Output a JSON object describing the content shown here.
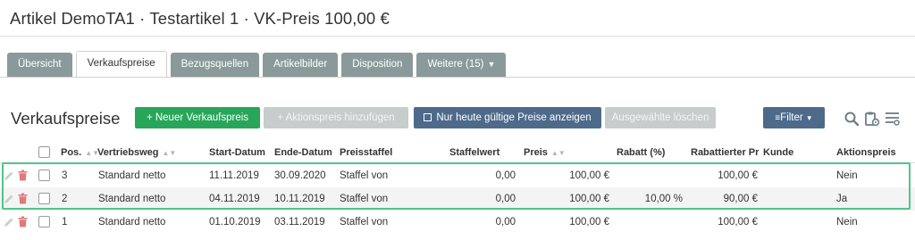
{
  "page": {
    "title": "Artikel DemoTA1 · Testartikel 1 · VK-Preis 100,00 €"
  },
  "tabs": [
    {
      "label": "Übersicht"
    },
    {
      "label": "Verkaufspreise"
    },
    {
      "label": "Bezugsquellen"
    },
    {
      "label": "Artikelbilder"
    },
    {
      "label": "Disposition"
    },
    {
      "label": "Weitere (15)"
    }
  ],
  "section": {
    "title": "Verkaufspreise"
  },
  "toolbar": {
    "new_label": "+  Neuer Verkaufspreis",
    "aktion_label": "+  Aktionspreis hinzufügen",
    "today_label": "Nur heute gültige Preise anzeigen",
    "delete_label": "Ausgewählte löschen",
    "filter_label": "Filter"
  },
  "colors": {
    "accent_green": "#27a65a",
    "accent_blue": "#4d6a8a",
    "tab_gray": "#8a9a9a",
    "highlight": "#4fc48a",
    "delete_red": "#e07a7a"
  },
  "table": {
    "headers": {
      "pos": "Pos.",
      "vertriebsweg": "Vertriebsweg",
      "start": "Start-Datum",
      "ende": "Ende-Datum",
      "staffel": "Preisstaffel",
      "staffelwert": "Staffelwert",
      "preis": "Preis",
      "rabatt": "Rabatt (%)",
      "rabattiert": "Rabattierter Pr",
      "kunde": "Kunde",
      "aktion": "Aktionspreis"
    },
    "rows": [
      {
        "pos": "3",
        "vertriebsweg": "Standard netto",
        "start": "11.11.2019",
        "ende": "30.09.2020",
        "staffel": "Staffel von",
        "staffelwert": "0,00",
        "preis": "100,00 €",
        "rabatt": "",
        "rabattiert": "100,00 €",
        "kunde": "",
        "aktion": "Nein"
      },
      {
        "pos": "2",
        "vertriebsweg": "Standard netto",
        "start": "04.11.2019",
        "ende": "10.11.2019",
        "staffel": "Staffel von",
        "staffelwert": "0,00",
        "preis": "100,00 €",
        "rabatt": "10,00 %",
        "rabattiert": "90,00 €",
        "kunde": "",
        "aktion": "Ja"
      },
      {
        "pos": "1",
        "vertriebsweg": "Standard netto",
        "start": "01.10.2019",
        "ende": "03.11.2019",
        "staffel": "Staffel von",
        "staffelwert": "0,00",
        "preis": "100,00 €",
        "rabatt": "",
        "rabattiert": "100,00 €",
        "kunde": "",
        "aktion": "Nein"
      }
    ]
  }
}
